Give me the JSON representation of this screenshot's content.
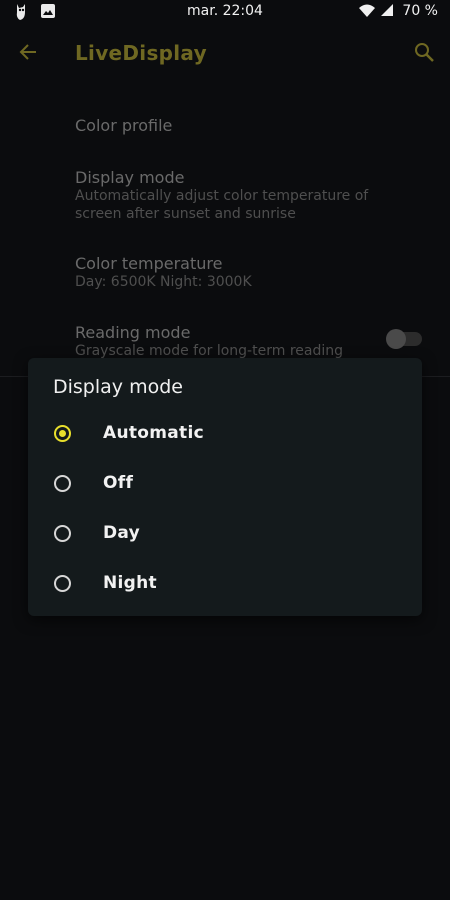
{
  "status_bar": {
    "time": "mar. 22:04",
    "battery": "70 %"
  },
  "app_bar": {
    "title": "LiveDisplay"
  },
  "settings": [
    {
      "title": "Color profile",
      "summary": ""
    },
    {
      "title": "Display mode",
      "summary": "Automatically adjust color temperature of screen after sunset and sunrise"
    },
    {
      "title": "Color temperature",
      "summary": "Day: 6500K Night: 3000K"
    },
    {
      "title": "Reading mode",
      "summary": "Grayscale mode for long-term reading"
    }
  ],
  "reading_mode_enabled": false,
  "dialog": {
    "title": "Display mode",
    "options": [
      "Automatic",
      "Off",
      "Day",
      "Night"
    ],
    "selected": "Automatic"
  },
  "colors": {
    "accent": "#e8df2c",
    "title_dim": "#6f6822",
    "background": "#0b0c0e",
    "dialog_bg": "#141a1c"
  }
}
